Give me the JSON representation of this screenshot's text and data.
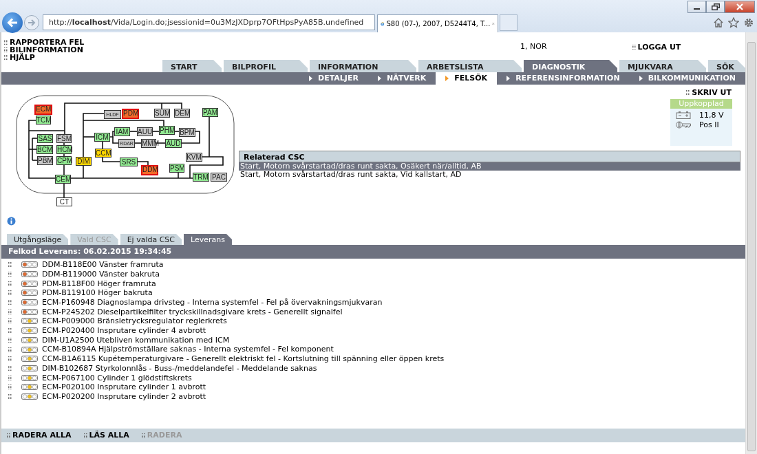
{
  "browser": {
    "url": "http://**localhost**/Vida/Login.do;jsessionid=0u3MzJXDprp7OFtHpsPyA85B.undefined",
    "tab_title": "S80 (07-), 2007, D5244T4, T..."
  },
  "side_links": [
    "RAPPORTERA FEL",
    "BILINFORMATION",
    "HJÄLP"
  ],
  "user": "1, NOR",
  "logout": "LOGGA UT",
  "main_tabs": [
    {
      "label": "START",
      "selected": false
    },
    {
      "label": "BILPROFIL",
      "selected": false
    },
    {
      "label": "INFORMATION",
      "selected": false
    },
    {
      "label": "ARBETSLISTA",
      "selected": false
    },
    {
      "label": "DIAGNOSTIK",
      "selected": true
    },
    {
      "label": "MJUKVARA",
      "selected": false
    },
    {
      "label": "SÖK",
      "selected": false
    }
  ],
  "sub_tabs": [
    {
      "label": "DETALJER",
      "selected": false
    },
    {
      "label": "NÄTVERK",
      "selected": false
    },
    {
      "label": "FELSÖK",
      "selected": true
    },
    {
      "label": "REFERENSINFORMATION",
      "selected": false
    },
    {
      "label": "BILKOMMUNIKATION",
      "selected": false
    }
  ],
  "print": "SKRIV UT",
  "connection": {
    "status": "Uppkopplad",
    "voltage": "11,8 V",
    "ignition": "Pos II"
  },
  "network": {
    "nodes": [
      {
        "label": "ECM",
        "color": "#f26b2a",
        "fault": true
      },
      {
        "label": "TCM",
        "color": "#90e890",
        "fault": false
      },
      {
        "label": "SAS",
        "color": "#90e890",
        "fault": false
      },
      {
        "label": "FSM",
        "color": "#c8c8c8",
        "fault": false
      },
      {
        "label": "BCM",
        "color": "#90e890",
        "fault": false
      },
      {
        "label": "HCM",
        "color": "#90e890",
        "fault": false
      },
      {
        "label": "PBM",
        "color": "#c8c8c8",
        "fault": false
      },
      {
        "label": "CPM",
        "color": "#90e890",
        "fault": false
      },
      {
        "label": "DIM",
        "color": "#ffd700",
        "fault": false
      },
      {
        "label": "CEM",
        "color": "#90e890",
        "fault": false
      },
      {
        "label": "CT",
        "color": "#ffffff",
        "fault": false
      },
      {
        "label": "HLDF",
        "color": "#c8c8c8",
        "fault": false
      },
      {
        "label": "PDM",
        "color": "#f26b2a",
        "fault": true
      },
      {
        "label": "SUM",
        "color": "#c8c8c8",
        "fault": false
      },
      {
        "label": "DEM",
        "color": "#c8c8c8",
        "fault": false
      },
      {
        "label": "PAM",
        "color": "#90e890",
        "fault": false
      },
      {
        "label": "IAM",
        "color": "#90e890",
        "fault": false
      },
      {
        "label": "AUU",
        "color": "#c8c8c8",
        "fault": false
      },
      {
        "label": "PHM",
        "color": "#90e890",
        "fault": false
      },
      {
        "label": "BPM",
        "color": "#c8c8c8",
        "fault": false
      },
      {
        "label": "ICM",
        "color": "#90e890",
        "fault": false
      },
      {
        "label": "RDAR",
        "color": "#c8c8c8",
        "fault": false
      },
      {
        "label": "MMM",
        "color": "#c8c8c8",
        "fault": false
      },
      {
        "label": "AUD",
        "color": "#90e890",
        "fault": false
      },
      {
        "label": "CCM",
        "color": "#ffd700",
        "fault": false
      },
      {
        "label": "SRS",
        "color": "#90e890",
        "fault": false
      },
      {
        "label": "DDM",
        "color": "#f26b2a",
        "fault": true
      },
      {
        "label": "KVM",
        "color": "#c8c8c8",
        "fault": false
      },
      {
        "label": "PSM",
        "color": "#90e890",
        "fault": false
      },
      {
        "label": "TRM",
        "color": "#90e890",
        "fault": false
      },
      {
        "label": "PAC",
        "color": "#c8c8c8",
        "fault": false
      }
    ]
  },
  "related_csc": {
    "title": "Relaterad CSC",
    "rows": [
      {
        "text": "Start, Motorn svårstartad/dras runt sakta, Osäkert när/alltid, AB",
        "selected": true
      },
      {
        "text": "Start, Motorn svårstartad/dras runt sakta, Vid kallstart, AD",
        "selected": false
      }
    ]
  },
  "result_tabs": [
    {
      "label": "Utgångsläge",
      "selected": false,
      "disabled": false
    },
    {
      "label": "Vald CSC",
      "selected": false,
      "disabled": true
    },
    {
      "label": "Ej valda CSC",
      "selected": false,
      "disabled": false
    },
    {
      "label": "Leverans",
      "selected": true,
      "disabled": false
    }
  ],
  "dtc_header": "Felkod Leverans: 06.02.2015 19:34:45",
  "dtcs": [
    {
      "kind": "error",
      "text": "DDM-B118E00 Vänster framruta"
    },
    {
      "kind": "error",
      "text": "DDM-B119000 Vänster bakruta"
    },
    {
      "kind": "error",
      "text": "PDM-B118F00 Höger framruta"
    },
    {
      "kind": "error",
      "text": "PDM-B119100 Höger bakruta"
    },
    {
      "kind": "error",
      "text": "ECM-P160948 Diagnoslampa drivsteg - Interna systemfel - Fel på övervakningsmjukvaran"
    },
    {
      "kind": "error",
      "text": "ECM-P245202 Dieselpartikelfilter tryckskillnadsgivare krets - Generellt signalfel"
    },
    {
      "kind": "warning",
      "text": "ECM-P009000 Bränsletrycksregulator reglerkrets"
    },
    {
      "kind": "warning",
      "text": "ECM-P020400 Insprutare cylinder 4 avbrott"
    },
    {
      "kind": "warning",
      "text": "DIM-U1A2500 Utebliven kommunikation med ICM"
    },
    {
      "kind": "warning",
      "text": "CCM-B10894A Hjälpströmställare saknas - Interna systemfel - Fel komponent"
    },
    {
      "kind": "warning",
      "text": "CCM-B1A6115 Kupétemperaturgivare - Generellt elektriskt fel - Kortslutning till spänning eller öppen krets"
    },
    {
      "kind": "warning",
      "text": "DIM-B102687 Styrkolonnlås - Buss-/meddelandefel - Meddelande saknas"
    },
    {
      "kind": "warning",
      "text": "ECM-P067100 Cylinder 1 glödstiftskrets"
    },
    {
      "kind": "warning",
      "text": "ECM-P020100 Insprutare cylinder 1 avbrott"
    },
    {
      "kind": "warning",
      "text": "ECM-P020200 Insprutare cylinder 2 avbrott"
    }
  ],
  "actions": [
    {
      "label": "RADERA ALLA",
      "disabled": false
    },
    {
      "label": "LÄS ALLA",
      "disabled": false
    },
    {
      "label": "RADERA",
      "disabled": true
    }
  ]
}
